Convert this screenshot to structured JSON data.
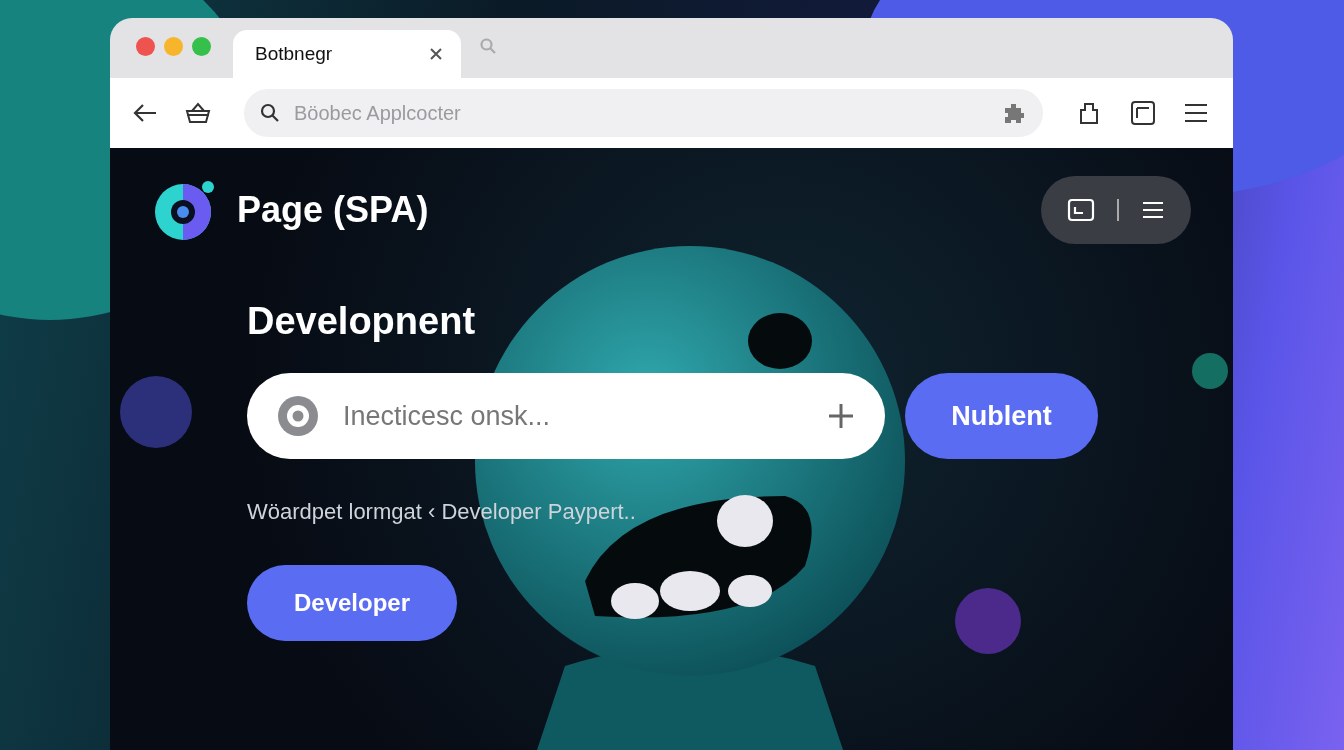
{
  "browser": {
    "tabs": [
      {
        "title": "Botbnegr",
        "selected": true
      }
    ],
    "address_bar": {
      "placeholder": "Böobec Applcocter"
    }
  },
  "page": {
    "brand": "Page (SPA)",
    "heading": "Developnent",
    "search": {
      "placeholder": "Inecticesc onsk..."
    },
    "search_button": "Nublent",
    "tagline": "Wöardpet lormgat ‹ Developer Paypert..",
    "cta_button": "Developer"
  }
}
